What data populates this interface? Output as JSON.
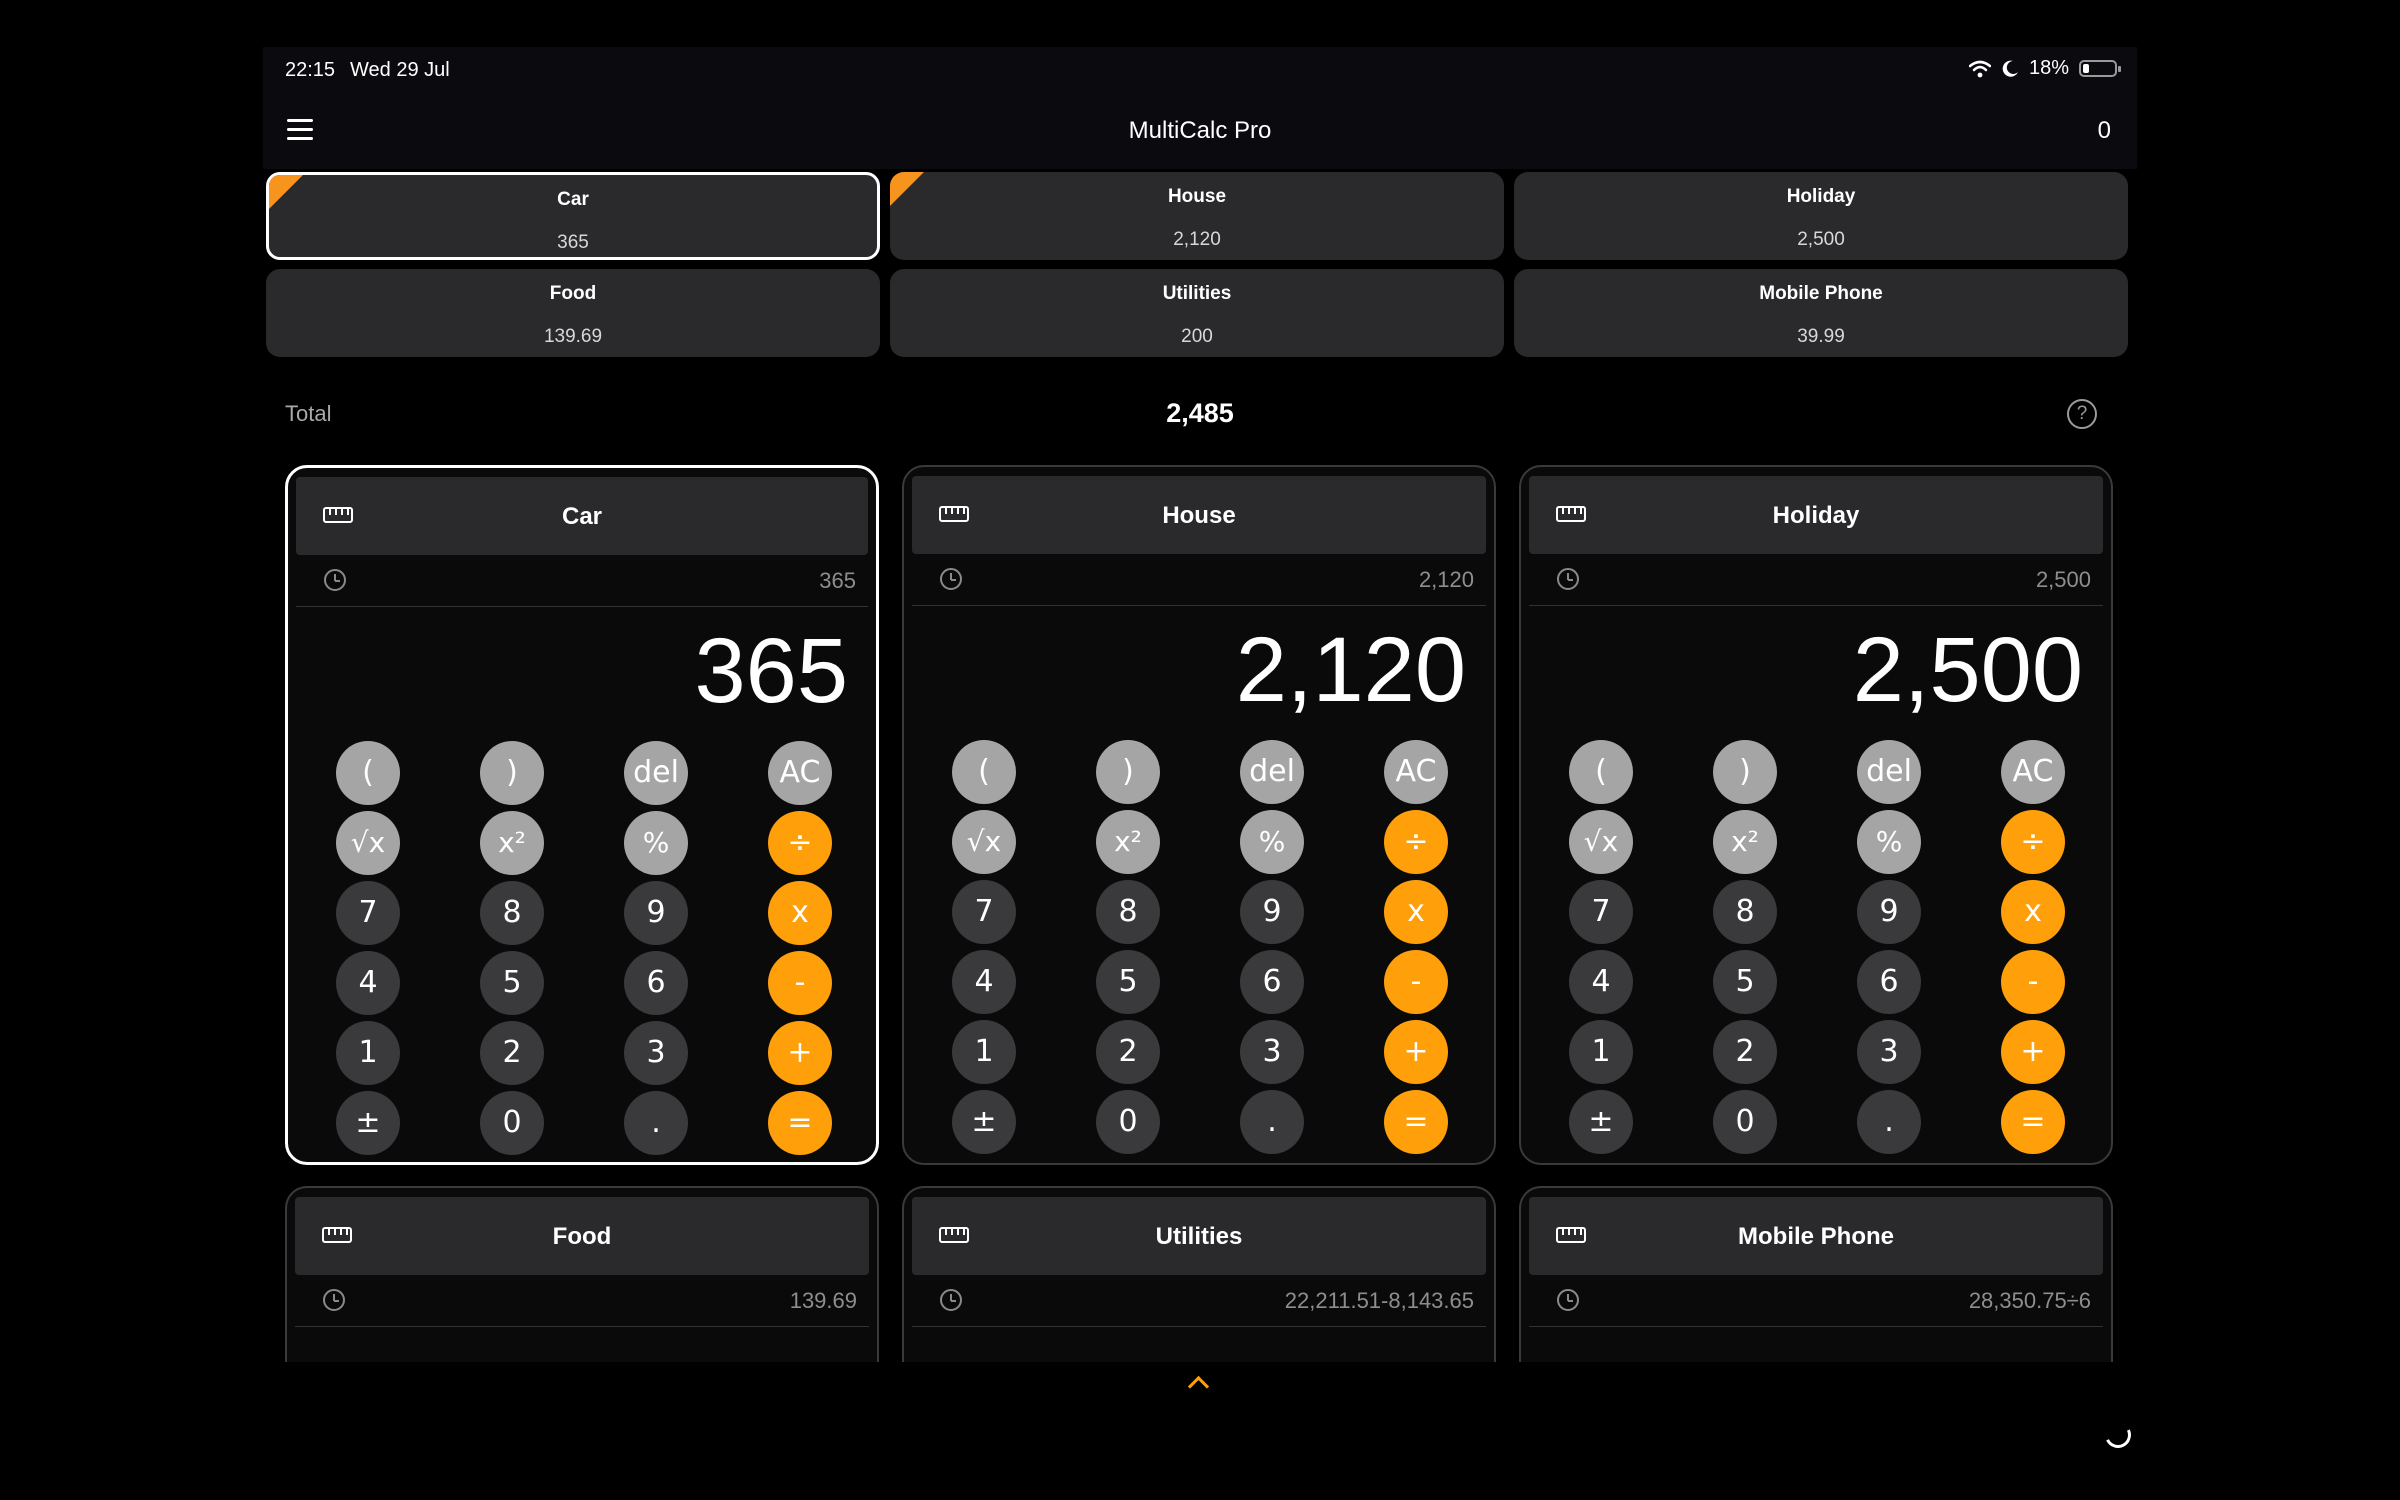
{
  "status": {
    "time": "22:15",
    "date": "Wed 29 Jul",
    "battery": "18%",
    "battery_level": 0.18,
    "icons": [
      "wifi-icon",
      "moon-icon",
      "battery-icon"
    ]
  },
  "titlebar": {
    "title": "MultiCalc Pro",
    "count": "0"
  },
  "tiles": [
    {
      "name": "Car",
      "value": "365"
    },
    {
      "name": "House",
      "value": "2,120"
    },
    {
      "name": "Holiday",
      "value": "2,500"
    },
    {
      "name": "Food",
      "value": "139.69"
    },
    {
      "name": "Utilities",
      "value": "200"
    },
    {
      "name": "Mobile Phone",
      "value": "39.99"
    }
  ],
  "total": {
    "label": "Total",
    "value": "2,485",
    "help": "?"
  },
  "calculators": [
    {
      "title": "Car",
      "history": "365",
      "display": "365"
    },
    {
      "title": "House",
      "history": "2,120",
      "display": "2,120"
    },
    {
      "title": "Holiday",
      "history": "2,500",
      "display": "2,500"
    },
    {
      "title": "Food",
      "history": "139.69"
    },
    {
      "title": "Utilities",
      "history": "22,211.51-8,143.65"
    },
    {
      "title": "Mobile Phone",
      "history": "28,350.75÷6"
    }
  ],
  "keypad": [
    [
      "(",
      ")",
      "del",
      "AC"
    ],
    [
      "√x",
      "x²",
      "%",
      "÷"
    ],
    [
      "7",
      "8",
      "9",
      "x"
    ],
    [
      "4",
      "5",
      "6",
      "-"
    ],
    [
      "1",
      "2",
      "3",
      "+"
    ],
    [
      "±",
      "0",
      ".",
      "="
    ]
  ],
  "colors": {
    "accent": "#ff9f0a",
    "tile_bg": "#2a2a2c",
    "key_light": "#a5a5a5",
    "key_dark": "#3a3a3c"
  }
}
